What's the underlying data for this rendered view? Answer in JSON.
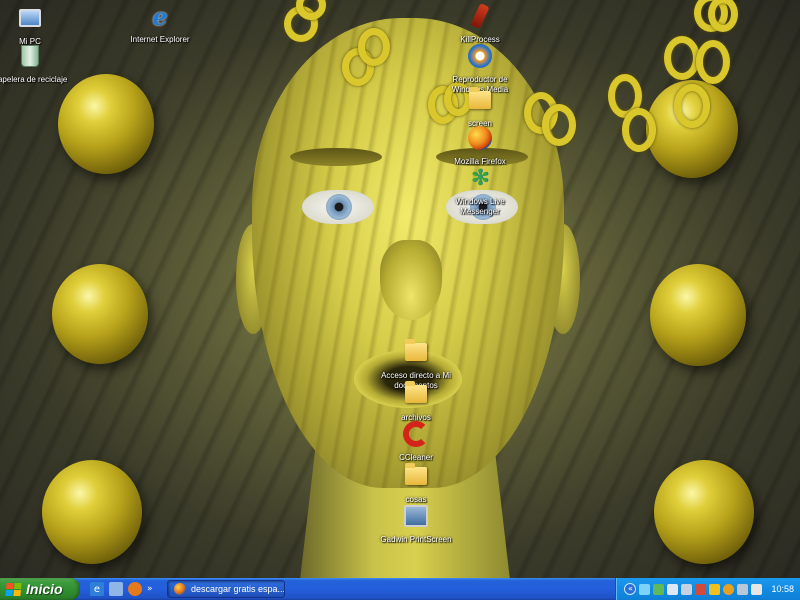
{
  "desktop": {
    "icons": [
      {
        "label": "Mi PC",
        "icon": "my-computer-icon"
      },
      {
        "label": "Papelera de reciclaje",
        "icon": "recycle-bin-icon"
      },
      {
        "label": "Internet Explorer",
        "icon": "internet-explorer-icon"
      },
      {
        "label": "KillProcess",
        "icon": "killprocess-icon"
      },
      {
        "label": "Reproductor de Windows Media",
        "icon": "windows-media-player-icon"
      },
      {
        "label": "screen",
        "icon": "folder-icon"
      },
      {
        "label": "Mozilla Firefox",
        "icon": "firefox-icon"
      },
      {
        "label": "Windows Live Messenger",
        "icon": "messenger-icon"
      },
      {
        "label": "Acceso directo a Mi documentos",
        "icon": "folder-icon"
      },
      {
        "label": "archivos",
        "icon": "folder-icon"
      },
      {
        "label": "CCleaner",
        "icon": "ccleaner-icon"
      },
      {
        "label": "cosas",
        "icon": "folder-icon"
      },
      {
        "label": "Gadwin PrintScreen",
        "icon": "screenshot-tool-icon"
      }
    ]
  },
  "taskbar": {
    "start_label": "Inicio",
    "quick_launch": [
      {
        "icon": "internet-explorer-icon",
        "color": "#2f7fd8"
      },
      {
        "icon": "show-desktop-icon",
        "color": "#8fb6e6"
      },
      {
        "icon": "firefox-icon",
        "color": "#e47a1c"
      }
    ],
    "quick_launch_more": "»",
    "tasks": [
      {
        "label": "descargar gratis espa...",
        "icon": "firefox-icon"
      }
    ],
    "tray": {
      "chevron": "«",
      "icons": [
        {
          "icon": "network-icon",
          "color": "#7bd3f7"
        },
        {
          "icon": "messenger-tray-icon",
          "color": "#5fb85a"
        },
        {
          "icon": "monitor-icon",
          "color": "#dfe8f2"
        },
        {
          "icon": "speaker-icon",
          "color": "#c6d2e0"
        },
        {
          "icon": "security-icon",
          "color": "#d44a3a"
        },
        {
          "icon": "zonealarm-icon",
          "color": "#f0c020"
        },
        {
          "icon": "antivirus-icon",
          "color": "#e8a020"
        },
        {
          "icon": "safely-remove-icon",
          "color": "#b9c7d6"
        },
        {
          "icon": "volume-icon",
          "color": "#e6e6e6"
        }
      ],
      "clock": "10:58"
    }
  },
  "colors": {
    "taskbar_blue": "#245edc",
    "start_green": "#3c9b3c",
    "tray_blue": "#138ee5",
    "wallpaper_gold": "#d9c72c"
  }
}
